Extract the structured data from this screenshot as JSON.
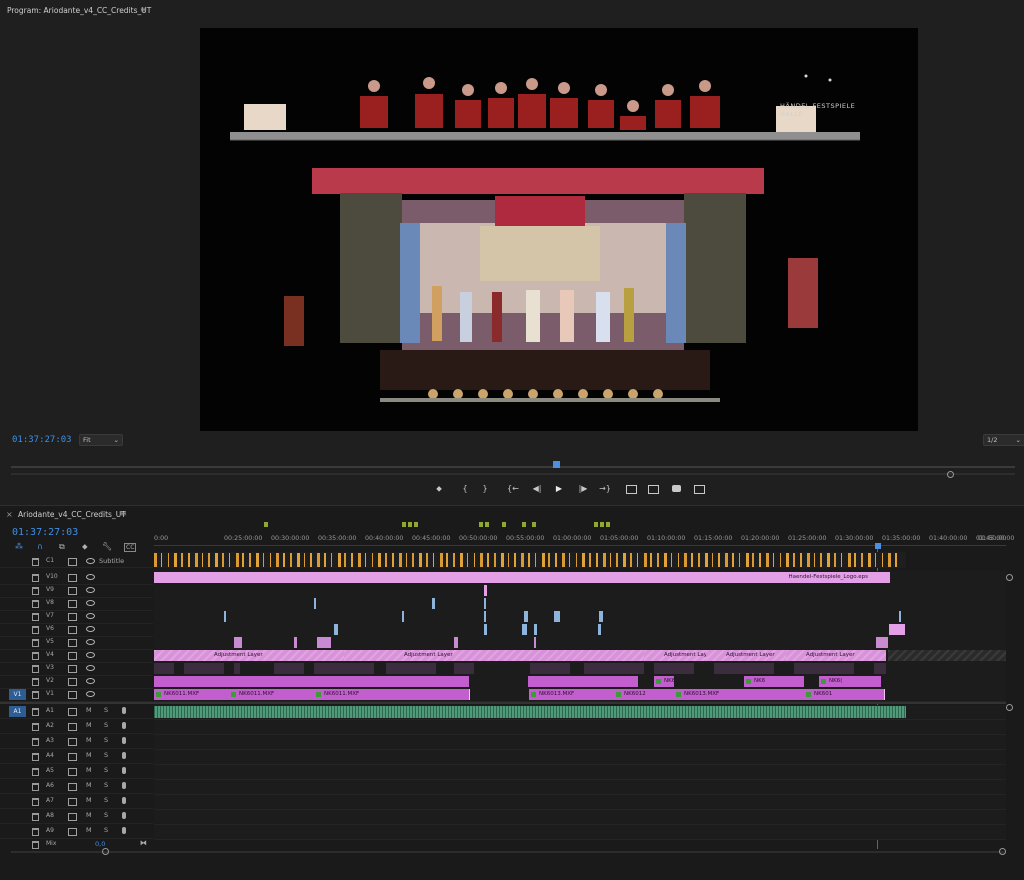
{
  "program_monitor": {
    "title": "Program: Ariodante_v4_CC_Credits_UT",
    "timecode": "01:37:27:03",
    "fit_label": "Fit",
    "resolution_label": "1/2",
    "video_watermark": "HÄNDEL FESTSPIELE HALLE",
    "playhead_fraction": 0.555,
    "transport": {
      "add_marker": "marker-icon",
      "mark_in": "{",
      "mark_out": "}",
      "go_to_in": "{←",
      "step_back": "◀|",
      "play": "▶",
      "step_forward": "|▶",
      "go_to_out": "→}",
      "lift": "lift-icon",
      "extract": "extract-icon",
      "export_frame": "camera-icon",
      "comparison_view": "comparison-icon"
    }
  },
  "timeline": {
    "sequence_name": "Ariodante_v4_CC_Credits_UT",
    "timecode": "01:37:27:03",
    "subtitle_track": "Subtitle",
    "caption_track": "C1",
    "ruler_labels": [
      "0:00",
      "00:25:00:00",
      "00:30:00:00",
      "00:35:00:00",
      "00:40:00:00",
      "00:45:00:00",
      "00:50:00:00",
      "00:55:00:00",
      "01:00:00:00",
      "01:05:00:00",
      "01:10:00:00",
      "01:15:00:00",
      "01:20:00:00",
      "01:25:00:00",
      "01:30:00:00",
      "01:35:00:00",
      "01:40:00:00",
      "01:45:00:00",
      "01:50:00"
    ],
    "video_tracks": [
      "V10",
      "V9",
      "V8",
      "V7",
      "V6",
      "V5",
      "V4",
      "V3",
      "V2",
      "V1"
    ],
    "audio_tracks": [
      "A1",
      "A2",
      "A3",
      "A4",
      "A5",
      "A6",
      "A7",
      "A8",
      "A9"
    ],
    "source_video": "V1",
    "source_audio": "A1",
    "mix_label": "Mix",
    "mix_value": "0,0",
    "mute_letter": "M",
    "solo_letter": "S",
    "clips": {
      "logo": "Haendel-Festspiele_Logo.eps",
      "adjustment": "Adjustment Layer",
      "v1_labels": [
        "NK6011.MXF",
        "NK6011.MXF",
        "NK6011.MXF",
        "NK6013.MXF",
        "NK6012",
        "NK6013.MXF",
        "NK601"
      ],
      "v2_labels": [
        "NK60",
        "NK6",
        "NK6("
      ]
    }
  },
  "colors": {
    "timecode_blue": "#3d8fe8",
    "clip_pink": "#e3a0e6",
    "clip_magenta": "#c25ecd",
    "audio_green": "#4f9a7b",
    "caption_orange": "#e0a23a",
    "playhead": "#4f8fe0"
  }
}
